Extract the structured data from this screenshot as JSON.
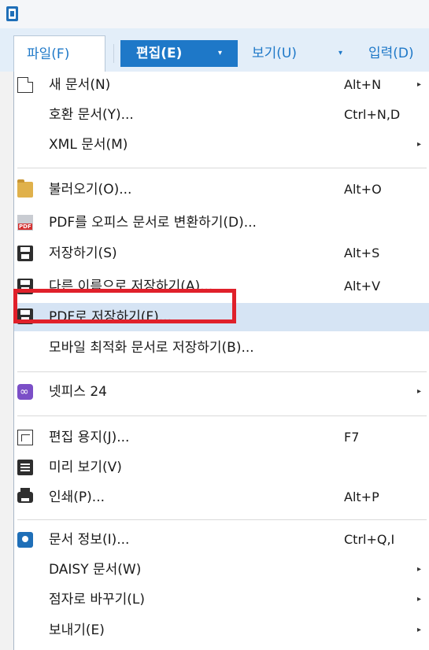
{
  "menubar": {
    "file": "파일(F)",
    "edit": "편집(E)",
    "view": "보기(U)",
    "input": "입력(D)",
    "arrow": "▾"
  },
  "menu": {
    "items": [
      {
        "label": "새 문서(N)",
        "shortcut": "Alt+N",
        "sub": "▸",
        "icon": "new-document-icon"
      },
      {
        "label": "호환 문서(Y)...",
        "shortcut": "Ctrl+N,D",
        "sub": "",
        "icon": ""
      },
      {
        "label": "XML 문서(M)",
        "shortcut": "",
        "sub": "▸",
        "icon": ""
      },
      {
        "label": "불러오기(O)...",
        "shortcut": "Alt+O",
        "sub": "",
        "icon": "open-folder-icon"
      },
      {
        "label": "PDF를 오피스 문서로 변환하기(D)...",
        "shortcut": "",
        "sub": "",
        "icon": "pdf-convert-icon"
      },
      {
        "label": "저장하기(S)",
        "shortcut": "Alt+S",
        "sub": "",
        "icon": "save-icon"
      },
      {
        "label": "다른 이름으로 저장하기(A)...",
        "shortcut": "Alt+V",
        "sub": "",
        "icon": "save-as-icon"
      },
      {
        "label": "PDF로 저장하기(F)...",
        "shortcut": "",
        "sub": "",
        "icon": "save-pdf-icon"
      },
      {
        "label": "모바일 최적화 문서로 저장하기(B)...",
        "shortcut": "",
        "sub": "",
        "icon": ""
      },
      {
        "label": "넷피스 24",
        "shortcut": "",
        "sub": "▸",
        "icon": "netffice-icon"
      },
      {
        "label": "편집 용지(J)...",
        "shortcut": "F7",
        "sub": "",
        "icon": "page-setup-icon"
      },
      {
        "label": "미리 보기(V)",
        "shortcut": "",
        "sub": "",
        "icon": "preview-icon"
      },
      {
        "label": "인쇄(P)...",
        "shortcut": "Alt+P",
        "sub": "",
        "icon": "print-icon"
      },
      {
        "label": "문서 정보(I)...",
        "shortcut": "Ctrl+Q,I",
        "sub": "",
        "icon": "document-info-icon"
      },
      {
        "label": "DAISY 문서(W)",
        "shortcut": "",
        "sub": "▸",
        "icon": ""
      },
      {
        "label": "점자로 바꾸기(L)",
        "shortcut": "",
        "sub": "▸",
        "icon": ""
      },
      {
        "label": "보내기(E)",
        "shortcut": "",
        "sub": "▸",
        "icon": ""
      }
    ]
  },
  "colors": {
    "accent": "#1e78c8",
    "highlight": "#d6e4f4",
    "annotation": "#e0202a"
  }
}
